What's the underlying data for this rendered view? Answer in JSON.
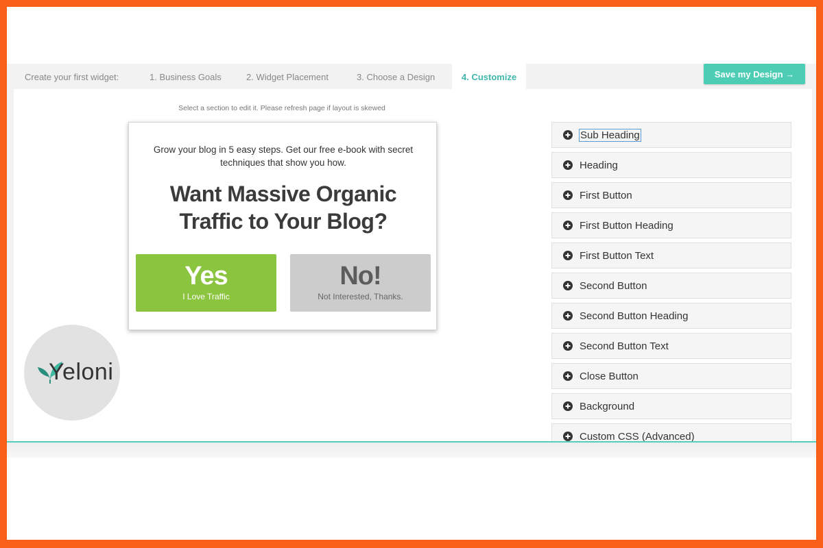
{
  "tabs": {
    "intro": "Create your first widget:",
    "items": [
      {
        "label": "1. Business Goals"
      },
      {
        "label": "2. Widget Placement"
      },
      {
        "label": "3. Choose a Design"
      },
      {
        "label": "4. Customize"
      }
    ],
    "active_index": 3
  },
  "save_button": {
    "label": "Save my Design →"
  },
  "hint": "Select a section to edit it. Please refresh page if layout is skewed",
  "popup": {
    "sub_heading": "Grow your blog in 5 easy steps. Get our free e-book with secret techniques that show you how.",
    "heading": "Want Massive Organic Traffic to Your Blog?",
    "first_button": {
      "heading": "Yes",
      "text": "I Love Traffic"
    },
    "second_button": {
      "heading": "No!",
      "text": "Not Interested, Thanks."
    }
  },
  "sections": [
    {
      "label": "Sub Heading"
    },
    {
      "label": "Heading"
    },
    {
      "label": "First Button"
    },
    {
      "label": "First Button Heading"
    },
    {
      "label": "First Button Text"
    },
    {
      "label": "Second Button"
    },
    {
      "label": "Second Button Heading"
    },
    {
      "label": "Second Button Text"
    },
    {
      "label": "Close Button"
    },
    {
      "label": "Background"
    },
    {
      "label": "Custom CSS (Advanced)"
    }
  ],
  "logo": {
    "text": "Yeloni",
    "icon": "leaf-icon"
  },
  "colors": {
    "frame": "#fa5f1a",
    "accent": "#4ecdb5",
    "active_tab": "#3fb8ac",
    "yes_button": "#8bc43f",
    "no_button": "#cccccc"
  }
}
